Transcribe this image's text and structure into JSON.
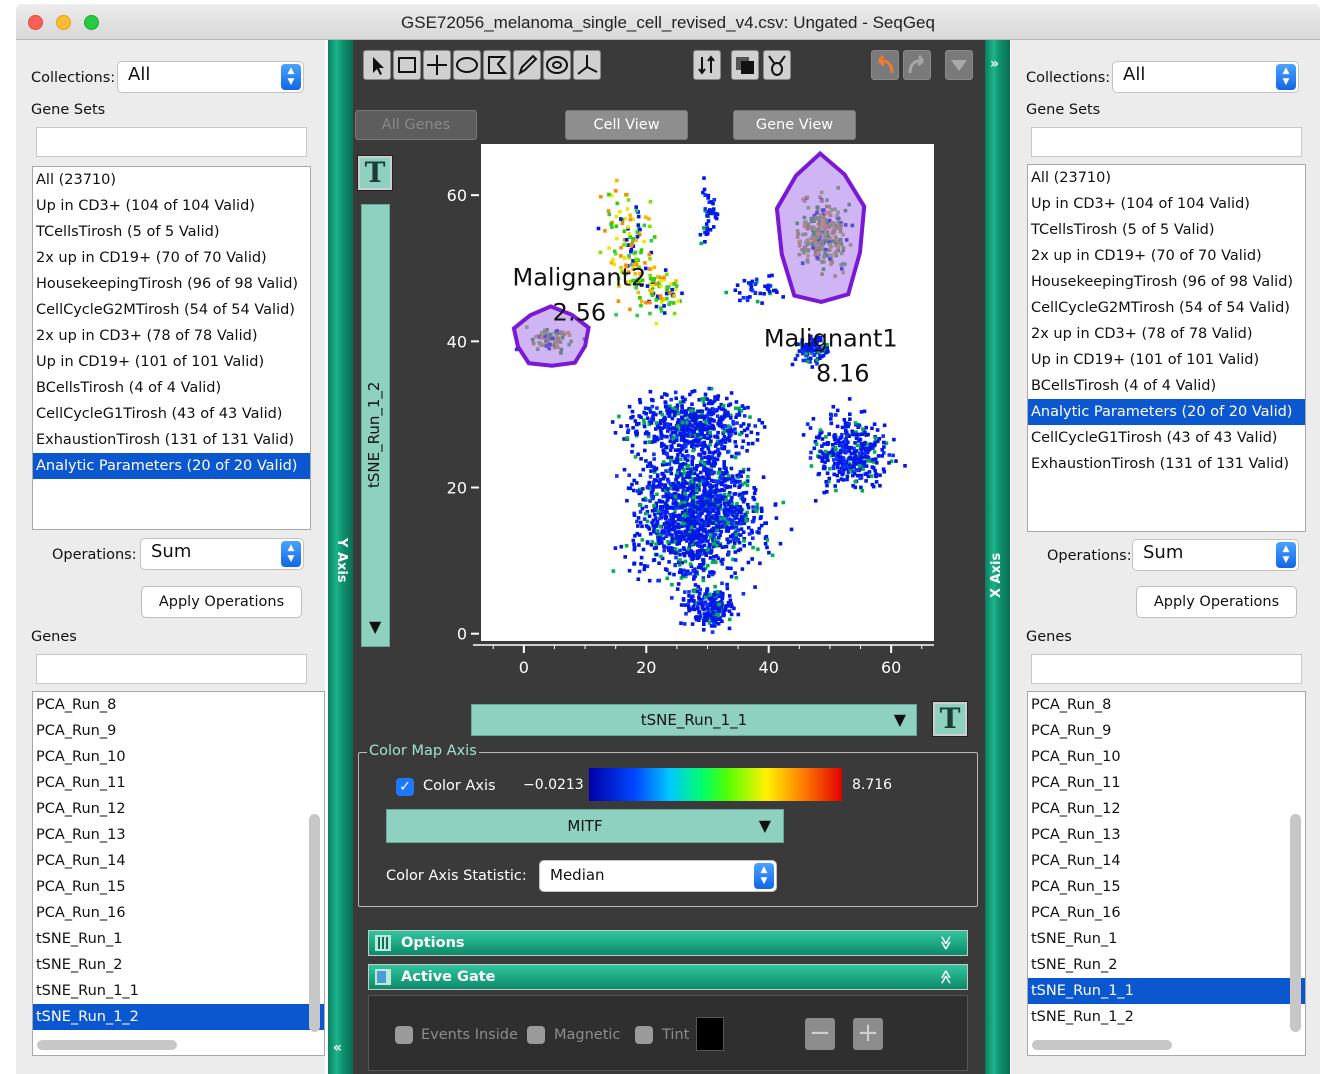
{
  "window": {
    "title": "GSE72056_melanoma_single_cell_revised_v4.csv: Ungated - SeqGeq"
  },
  "left_panel": {
    "collections_label": "Collections:",
    "collections_value": "All",
    "gene_sets_label": "Gene Sets",
    "gene_sets": [
      "All (23710)",
      "Up in CD3+ (104 of 104 Valid)",
      "TCellsTirosh (5 of 5 Valid)",
      "2x up in CD19+ (70 of 70 Valid)",
      "HousekeepingTirosh (96 of 98 Valid)",
      "CellCycleG2MTirosh (54 of 54 Valid)",
      "2x up in CD3+ (78 of 78 Valid)",
      "Up in CD19+ (101 of 101 Valid)",
      "BCellsTirosh (4 of 4 Valid)",
      "CellCycleG1Tirosh (43 of 43 Valid)",
      "ExhaustionTirosh (131 of 131 Valid)",
      "Analytic Parameters (20 of 20 Valid)"
    ],
    "gene_sets_selected": 11,
    "operations_label": "Operations:",
    "operations_value": "Sum",
    "apply_label": "Apply Operations",
    "genes_label": "Genes",
    "genes": [
      "PCA_Run_8",
      "PCA_Run_9",
      "PCA_Run_10",
      "PCA_Run_11",
      "PCA_Run_12",
      "PCA_Run_13",
      "PCA_Run_14",
      "PCA_Run_15",
      "PCA_Run_16",
      "tSNE_Run_1",
      "tSNE_Run_2",
      "tSNE_Run_1_1",
      "tSNE_Run_1_2"
    ],
    "genes_selected": 12
  },
  "right_panel": {
    "collections_label": "Collections:",
    "collections_value": "All",
    "gene_sets_label": "Gene Sets",
    "gene_sets": [
      "All (23710)",
      "Up in CD3+ (104 of 104 Valid)",
      "TCellsTirosh (5 of 5 Valid)",
      "2x up in CD19+ (70 of 70 Valid)",
      "HousekeepingTirosh (96 of 98 Valid)",
      "CellCycleG2MTirosh (54 of 54 Valid)",
      "2x up in CD3+ (78 of 78 Valid)",
      "Up in CD19+ (101 of 101 Valid)",
      "BCellsTirosh (4 of 4 Valid)",
      "Analytic Parameters (20 of 20 Valid)",
      "CellCycleG1Tirosh (43 of 43 Valid)",
      "ExhaustionTirosh (131 of 131 Valid)"
    ],
    "gene_sets_selected": 9,
    "operations_label": "Operations:",
    "operations_value": "Sum",
    "apply_label": "Apply Operations",
    "genes_label": "Genes",
    "genes": [
      "PCA_Run_8",
      "PCA_Run_9",
      "PCA_Run_10",
      "PCA_Run_11",
      "PCA_Run_12",
      "PCA_Run_13",
      "PCA_Run_14",
      "PCA_Run_15",
      "PCA_Run_16",
      "tSNE_Run_1",
      "tSNE_Run_2",
      "tSNE_Run_1_1",
      "tSNE_Run_1_2"
    ],
    "genes_selected": 11
  },
  "strips": {
    "y_axis_label": "Y Axis",
    "x_axis_label": "X Axis",
    "y_chevron": "«",
    "x_chevron": "»"
  },
  "center": {
    "views": {
      "all_genes": "All Genes",
      "cell_view": "Cell View",
      "gene_view": "Gene View"
    },
    "t_glyph": "T",
    "y_param": "tSNE_Run_1_2",
    "x_param": "tSNE_Run_1_1",
    "dropdown_arrow": "▼",
    "color_map": {
      "title": "Color Map Axis",
      "checkbox_label": "Color Axis",
      "min": "−0.0213",
      "max": "8.716",
      "gene": "MITF",
      "statistic_label": "Color Axis Statistic:",
      "statistic_value": "Median"
    },
    "options_label": "Options",
    "options_chevron": "≫",
    "active_gate_label": "Active Gate",
    "active_gate_chevron": "≪",
    "gate_options": {
      "events_inside": "Events Inside",
      "magnetic": "Magnetic",
      "tint": "Tint"
    },
    "minus_glyph": "−",
    "plus_glyph": "+"
  },
  "icons": {
    "tools": [
      "pointer-icon",
      "rectangle-gate-icon",
      "quadrant-gate-icon",
      "ellipse-gate-icon",
      "polygon-gate-icon",
      "pencil-icon",
      "spider-gate-icon",
      "crosshair-icon"
    ],
    "extra": [
      "vertical-arrows-icon",
      "layers-icon",
      "spider-plot-icon",
      "undo-icon",
      "redo-icon",
      "menu-triangle-icon"
    ]
  },
  "chart_data": {
    "type": "scatter",
    "xlabel": "tSNE_Run_1_1",
    "ylabel": "tSNE_Run_1_2",
    "xlim": [
      -7,
      67
    ],
    "ylim": [
      -1,
      67
    ],
    "xticks": [
      0,
      20,
      40,
      60
    ],
    "yticks": [
      0,
      20,
      40,
      60
    ],
    "color_axis": {
      "gene": "MITF",
      "min": -0.0213,
      "max": 8.716,
      "statistic": "Median"
    },
    "gates": [
      {
        "name": "Malignant1",
        "value": "8.16",
        "center": [
          48.5,
          55
        ],
        "radius": [
          7,
          10
        ]
      },
      {
        "name": "Malignant2",
        "value": "2.56",
        "center": [
          4.5,
          40.5
        ],
        "radius": [
          6,
          4
        ]
      }
    ],
    "clusters": [
      {
        "center": [
          28,
          17
        ],
        "spread": [
          10,
          9
        ],
        "n": 1500,
        "expression": "low"
      },
      {
        "center": [
          27,
          29
        ],
        "spread": [
          10,
          4
        ],
        "n": 500,
        "expression": "low"
      },
      {
        "center": [
          53,
          25
        ],
        "spread": [
          6,
          5
        ],
        "n": 380,
        "expression": "low"
      },
      {
        "center": [
          30,
          4
        ],
        "spread": [
          4,
          3
        ],
        "n": 200,
        "expression": "low"
      },
      {
        "center": [
          47,
          39
        ],
        "spread": [
          2.5,
          2
        ],
        "n": 90,
        "expression": "low"
      },
      {
        "center": [
          48.5,
          55
        ],
        "spread": [
          4,
          5
        ],
        "n": 260,
        "expression": "high"
      },
      {
        "center": [
          4.5,
          40.5
        ],
        "spread": [
          4,
          1.5
        ],
        "n": 70,
        "expression": "high"
      },
      {
        "center": [
          17,
          53
        ],
        "spread": [
          4,
          7
        ],
        "n": 130,
        "expression": "mixed"
      },
      {
        "center": [
          22,
          47
        ],
        "spread": [
          4,
          3
        ],
        "n": 80,
        "expression": "mixed"
      },
      {
        "center": [
          30,
          58
        ],
        "spread": [
          1.5,
          4
        ],
        "n": 40,
        "expression": "low"
      },
      {
        "center": [
          38,
          47
        ],
        "spread": [
          4,
          2.5
        ],
        "n": 40,
        "expression": "low"
      }
    ]
  }
}
